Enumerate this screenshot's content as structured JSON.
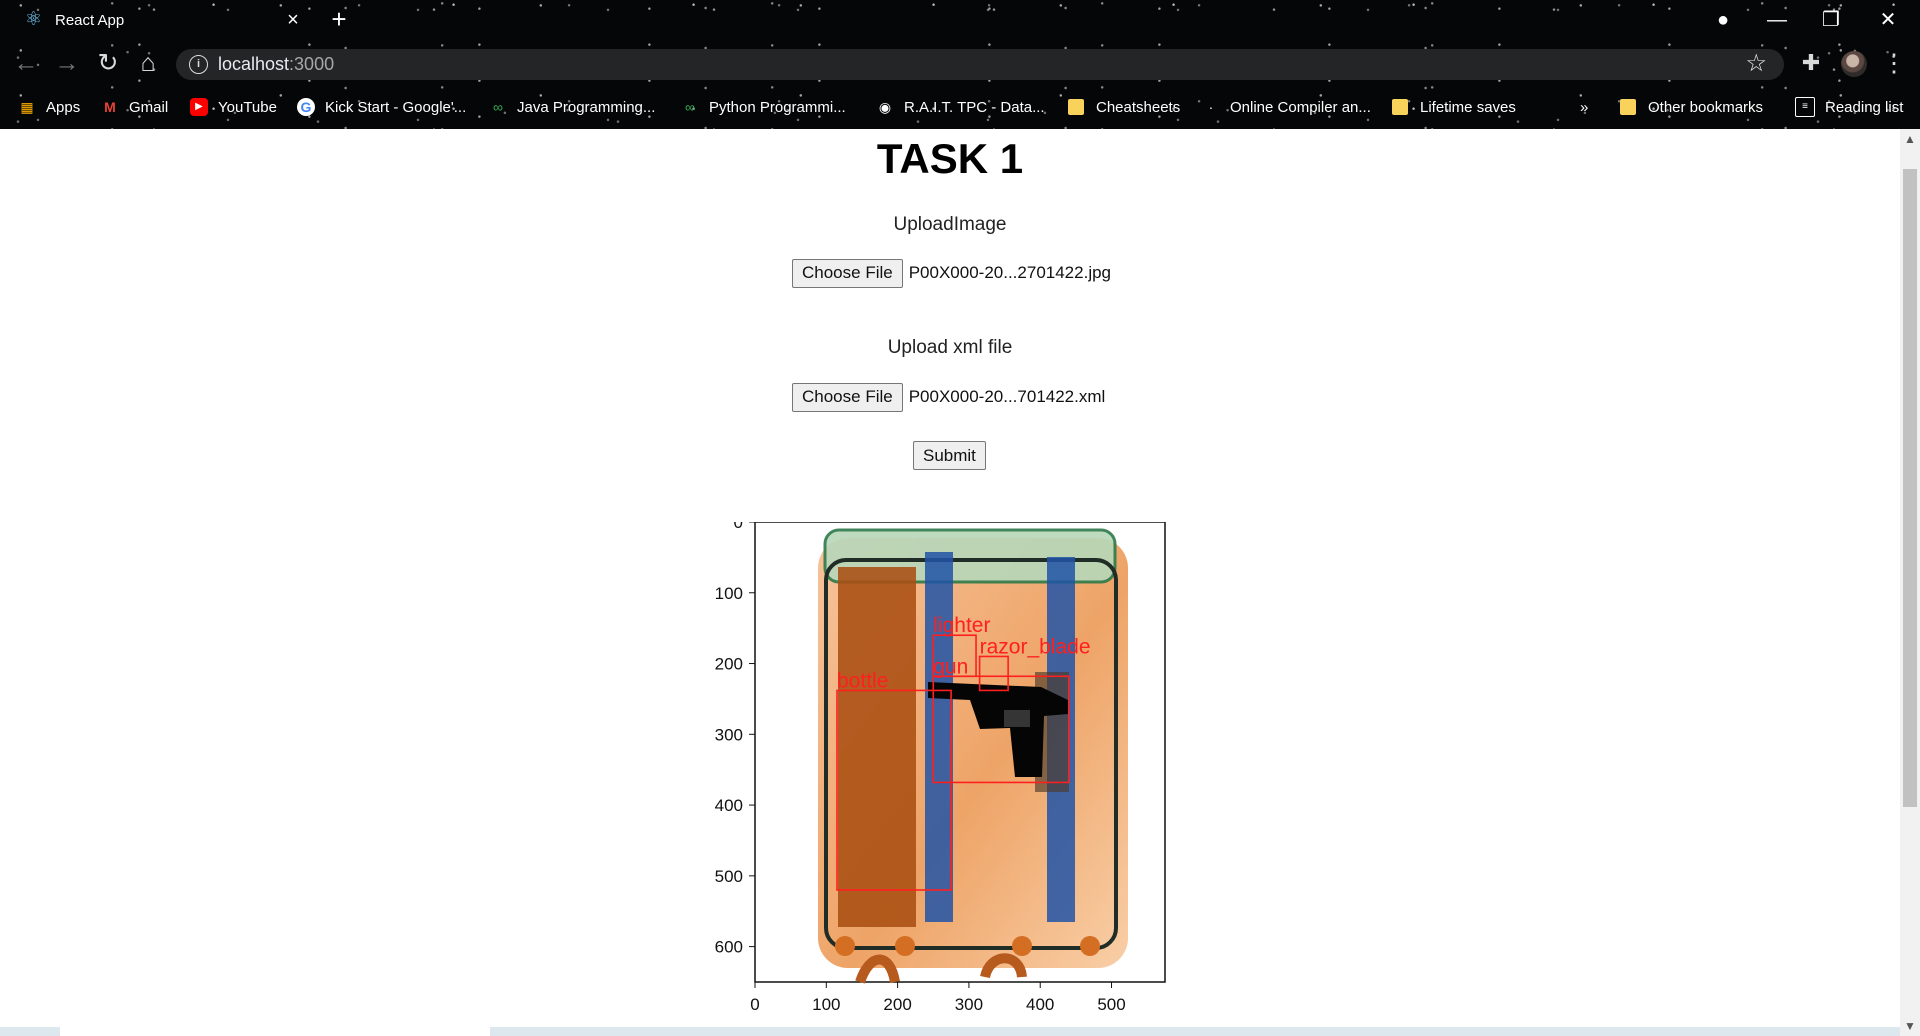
{
  "browser": {
    "tab": {
      "title": "React App",
      "favicon": "react-icon",
      "close": "×"
    },
    "new_tab": "+",
    "window_controls": {
      "extension": "●",
      "minimize": "—",
      "restore": "❐",
      "close": "✕"
    },
    "toolbar": {
      "back": "←",
      "forward": "→",
      "reload": "↻",
      "home": "⌂",
      "extensions": "✚",
      "menu": "⋮"
    },
    "address": {
      "host": "localhost",
      "port": ":3000",
      "info": "i",
      "star": "☆"
    },
    "bookmarks": [
      {
        "label": "Apps",
        "icon": "apps-icon"
      },
      {
        "label": "Gmail",
        "icon": "gmail-icon"
      },
      {
        "label": "YouTube",
        "icon": "youtube-icon"
      },
      {
        "label": "Kick Start - Google'...",
        "icon": "google-icon"
      },
      {
        "label": "Java Programming...",
        "icon": "link-icon"
      },
      {
        "label": "Python Programmi...",
        "icon": "link-icon"
      },
      {
        "label": "R.A.I.T. TPC - Data...",
        "icon": "website-icon"
      },
      {
        "label": "Cheatsheets",
        "icon": "folder-icon"
      },
      {
        "label": "Online Compiler an...",
        "icon": "link-icon"
      },
      {
        "label": "Lifetime saves",
        "icon": "folder-icon"
      },
      {
        "label": "»",
        "icon": ""
      },
      {
        "label": "Other bookmarks",
        "icon": "folder-icon"
      },
      {
        "label": "Reading list",
        "icon": "reading-list-icon"
      }
    ]
  },
  "page": {
    "title": "TASK 1",
    "upload_image": {
      "label": "UploadImage",
      "button": "Choose File",
      "filename": "P00X000-20...2701422.jpg"
    },
    "upload_xml": {
      "label": "Upload xml file",
      "button": "Choose File",
      "filename": "P00X000-20...701422.xml"
    },
    "submit": "Submit"
  },
  "chart_data": {
    "type": "image-with-annotations",
    "x_ticks": [
      "0",
      "100",
      "200",
      "300",
      "400",
      "500"
    ],
    "y_ticks": [
      "0",
      "100",
      "200",
      "300",
      "400",
      "500",
      "600"
    ],
    "xlim": [
      0,
      575
    ],
    "ylim": [
      650,
      0
    ],
    "annotations": [
      {
        "label": "lighter",
        "x": [
          250,
          310
        ],
        "y": [
          160,
          218
        ]
      },
      {
        "label": "razor_blade",
        "x": [
          315,
          355
        ],
        "y": [
          190,
          238
        ]
      },
      {
        "label": "gun",
        "x": [
          250,
          440
        ],
        "y": [
          218,
          368
        ]
      },
      {
        "label": "bottle",
        "x": [
          115,
          275
        ],
        "y": [
          238,
          520
        ]
      }
    ]
  }
}
